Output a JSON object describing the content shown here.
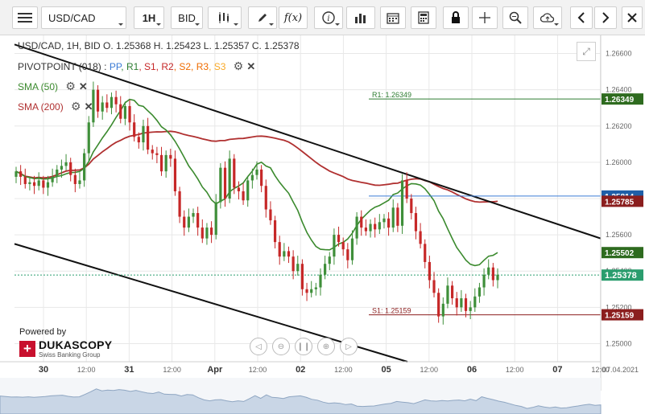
{
  "toolbar": {
    "menu_icon": "hamburger-menu-icon",
    "instrument": "USD/CAD",
    "timeframe": "1H",
    "price_side": "BID",
    "tool_icons": [
      "candlestick-icon",
      "pencil-icon",
      "function-icon",
      "info-icon",
      "bar-chart-icon",
      "calendar-icon",
      "calculator-icon",
      "lock-icon",
      "crosshair-icon",
      "zoom-icon",
      "cloud-upload-icon",
      "chevron-left-icon",
      "chevron-right-icon"
    ]
  },
  "legend": {
    "ohlc": "USD/CAD, 1H, BID   O. 1.25368 H. 1.25423 L. 1.25357 C. 1.25378",
    "pivot_label": "PIVOTPOINT (018)",
    "pivot_sep": " : ",
    "pivot_items": [
      {
        "text": "PP",
        "color": "#3a7bd5"
      },
      {
        "text": "R1",
        "color": "#2e7d32"
      },
      {
        "text": "S1",
        "color": "#c62828"
      },
      {
        "text": "R2",
        "color": "#c62828"
      },
      {
        "text": "S2",
        "color": "#ef6c00"
      },
      {
        "text": "R3",
        "color": "#ef6c00"
      },
      {
        "text": "S3",
        "color": "#f9a825"
      }
    ],
    "sma50": {
      "label": "SMA (50)",
      "color": "#3b8a2e"
    },
    "sma200": {
      "label": "SMA (200)",
      "color": "#b03030"
    }
  },
  "powered": {
    "text": "Powered by",
    "brand": "DUKASCOPY",
    "sub": "Swiss Banking Group"
  },
  "chart_data": {
    "type": "candlestick",
    "instrument": "USD/CAD",
    "timeframe": "1H",
    "ylim": [
      1.249,
      1.267
    ],
    "y_ticks": [
      1.25,
      1.252,
      1.254,
      1.256,
      1.258,
      1.26,
      1.262,
      1.264,
      1.266
    ],
    "y_tick_labels": [
      "1.25000",
      "1.25200",
      "1.25400",
      "1.25600",
      "1.25800",
      "1.26000",
      "1.26200",
      "1.26400",
      "1.26600"
    ],
    "x_labels": [
      "30",
      "12:00",
      "31",
      "12:00",
      "Apr",
      "12:00",
      "02",
      "12:00",
      "05",
      "12:00",
      "06",
      "12:00",
      "07",
      "12:00"
    ],
    "x_bold": [
      true,
      false,
      true,
      false,
      true,
      false,
      true,
      false,
      true,
      false,
      true,
      false,
      true,
      false
    ],
    "x_last_label": "07.04.2021",
    "candle_closes": [
      1.2595,
      1.2592,
      1.2588,
      1.2589,
      1.2587,
      1.259,
      1.2586,
      1.2589,
      1.2592,
      1.2596,
      1.2598,
      1.26,
      1.2593,
      1.2588,
      1.259,
      1.2605,
      1.2622,
      1.264,
      1.2628,
      1.2633,
      1.263,
      1.2636,
      1.2632,
      1.2624,
      1.2631,
      1.2622,
      1.2614,
      1.2611,
      1.262,
      1.2607,
      1.2605,
      1.2604,
      1.2595,
      1.2604,
      1.2602,
      1.2584,
      1.257,
      1.2564,
      1.257,
      1.2572,
      1.2564,
      1.2558,
      1.2564,
      1.256,
      1.2578,
      1.2597,
      1.258,
      1.2602,
      1.2586,
      1.2584,
      1.2579,
      1.259,
      1.2593,
      1.2596,
      1.2587,
      1.2574,
      1.2568,
      1.2556,
      1.2548,
      1.2551,
      1.2548,
      1.254,
      1.2544,
      1.253,
      1.2528,
      1.253,
      1.2531,
      1.2538,
      1.2544,
      1.2548,
      1.256,
      1.2556,
      1.2552,
      1.2546,
      1.2558,
      1.257,
      1.2564,
      1.2562,
      1.2566,
      1.2563,
      1.2567,
      1.2569,
      1.2564,
      1.2575,
      1.2565,
      1.259,
      1.258,
      1.2572,
      1.2562,
      1.2555,
      1.2545,
      1.2535,
      1.2528,
      1.2515,
      1.2522,
      1.2532,
      1.2525,
      1.252,
      1.2525,
      1.2518,
      1.252,
      1.2526,
      1.2531,
      1.2538,
      1.2542,
      1.2535,
      1.2538
    ],
    "sma50_value": 1.25502,
    "sma200_value": 1.25785,
    "pivot_pp": 1.25814,
    "pivot_r1": 1.26349,
    "pivot_s1": 1.25159,
    "pivot_r1_label": "R1: 1.26349",
    "pivot_s1_label": "S1: 1.25159",
    "last_close": 1.25378,
    "price_tags": [
      {
        "text": "1.26349",
        "value": 1.26349,
        "bg": "#2e6b1f"
      },
      {
        "text": "1.25814",
        "value": 1.25814,
        "bg": "#1f5fa8"
      },
      {
        "text": "1.25785",
        "value": 1.25785,
        "bg": "#8b1e1e"
      },
      {
        "text": "1.25502",
        "value": 1.25502,
        "bg": "#2e6b1f"
      },
      {
        "text": "1.25378",
        "value": 1.25378,
        "bg": "#2a9d6e"
      },
      {
        "text": "1.25159",
        "value": 1.25159,
        "bg": "#8b1e1e"
      }
    ],
    "colors": {
      "up": "#3f8f3a",
      "down": "#c62828",
      "bg": "#ffffff",
      "grid": "#e8e8e8"
    }
  }
}
